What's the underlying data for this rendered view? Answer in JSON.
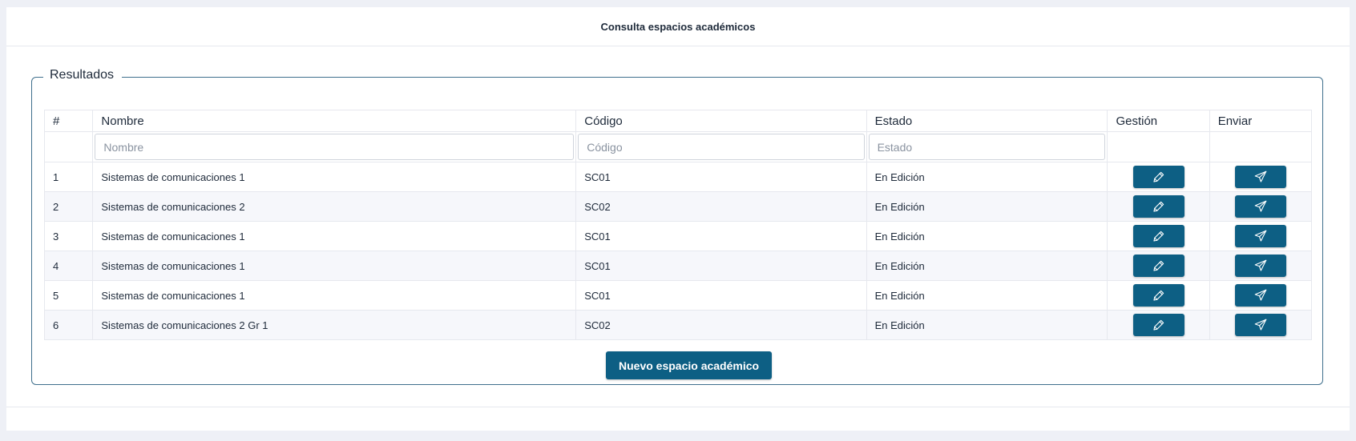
{
  "header": {
    "title": "Consulta espacios académicos"
  },
  "results": {
    "legend": "Resultados",
    "columns": [
      "#",
      "Nombre",
      "Código",
      "Estado",
      "Gestión",
      "Enviar"
    ],
    "filters": {
      "nombre_placeholder": "Nombre",
      "codigo_placeholder": "Código",
      "estado_placeholder": "Estado"
    },
    "rows": [
      {
        "num": "1",
        "nombre": "Sistemas de comunicaciones 1",
        "codigo": "SC01",
        "estado": "En Edición"
      },
      {
        "num": "2",
        "nombre": "Sistemas de comunicaciones 2",
        "codigo": "SC02",
        "estado": "En Edición"
      },
      {
        "num": "3",
        "nombre": "Sistemas de comunicaciones 1",
        "codigo": "SC01",
        "estado": "En Edición"
      },
      {
        "num": "4",
        "nombre": "Sistemas de comunicaciones 1",
        "codigo": "SC01",
        "estado": "En Edición"
      },
      {
        "num": "5",
        "nombre": "Sistemas de comunicaciones 1",
        "codigo": "SC01",
        "estado": "En Edición"
      },
      {
        "num": "6",
        "nombre": "Sistemas de comunicaciones 2 Gr 1",
        "codigo": "SC02",
        "estado": "En Edición"
      }
    ],
    "row_icons": {
      "gestion": "pencil-icon",
      "enviar": "send-icon"
    },
    "new_button_label": "Nuevo espacio académico"
  },
  "colors": {
    "primary": "#0d5f84",
    "border": "#3f6f8c",
    "background": "#eef0f6"
  }
}
